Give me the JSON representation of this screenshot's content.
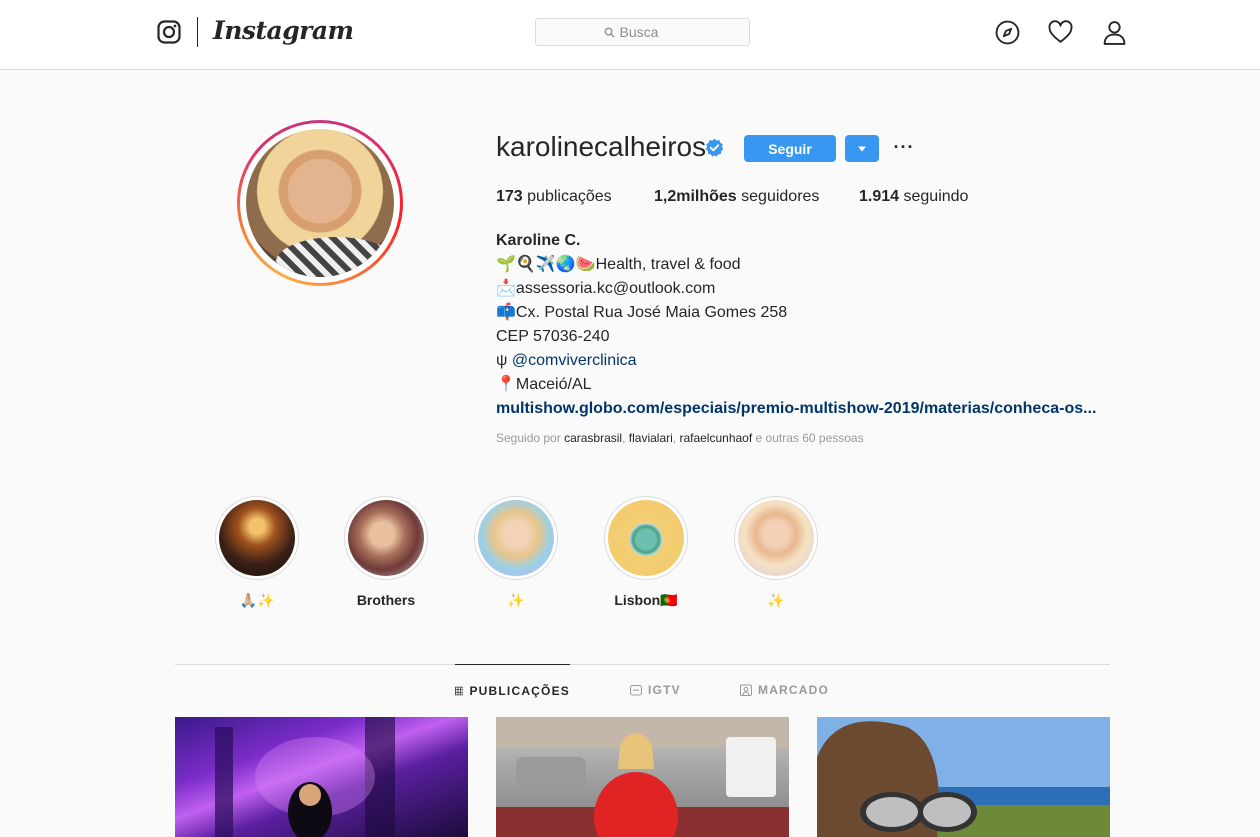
{
  "nav": {
    "wordmark": "Instagram",
    "search_placeholder": "Busca"
  },
  "profile": {
    "username": "karolinecalheiros",
    "follow_label": "Seguir",
    "more_label": "···",
    "stats": {
      "posts_count": "173",
      "posts_label": " publicações",
      "followers_count": "1,2milhões",
      "followers_label": " seguidores",
      "following_count": "1.914",
      "following_label": " seguindo"
    },
    "bio": {
      "name": "Karoline C.",
      "line1": "🌱🍳✈️🌏🍉Health, travel & food",
      "line2": "📩assessoria.kc@outlook.com",
      "line3": "📫Cx. Postal Rua José Maia Gomes 258",
      "line4": "CEP 57036-240",
      "line5_prefix": "ψ ",
      "line5_mention": "@comviverclinica",
      "line6": "📍Maceió/AL",
      "url": "multishow.globo.com/especiais/premio-multishow-2019/materias/conheca-os..."
    },
    "followed_by": {
      "prefix": "Seguido por ",
      "accounts": [
        "carasbrasil",
        "flavialari",
        "rafaelcunhaof"
      ],
      "suffix": " e outras 60 pessoas"
    }
  },
  "highlights": [
    {
      "label": "🙏🏼✨"
    },
    {
      "label": "Brothers"
    },
    {
      "label": "✨"
    },
    {
      "label": "Lisbon🇵🇹"
    },
    {
      "label": "✨"
    }
  ],
  "tabs": [
    {
      "label": "PUBLICAÇÕES",
      "icon": "grid-icon",
      "active": true
    },
    {
      "label": "IGTV",
      "icon": "tv-icon",
      "active": false
    },
    {
      "label": "MARCADO",
      "icon": "tagged-icon",
      "active": false
    }
  ],
  "colors": {
    "accent": "#3897f0",
    "link": "#003569",
    "border": "#dbdbdb",
    "background": "#fafafa"
  }
}
